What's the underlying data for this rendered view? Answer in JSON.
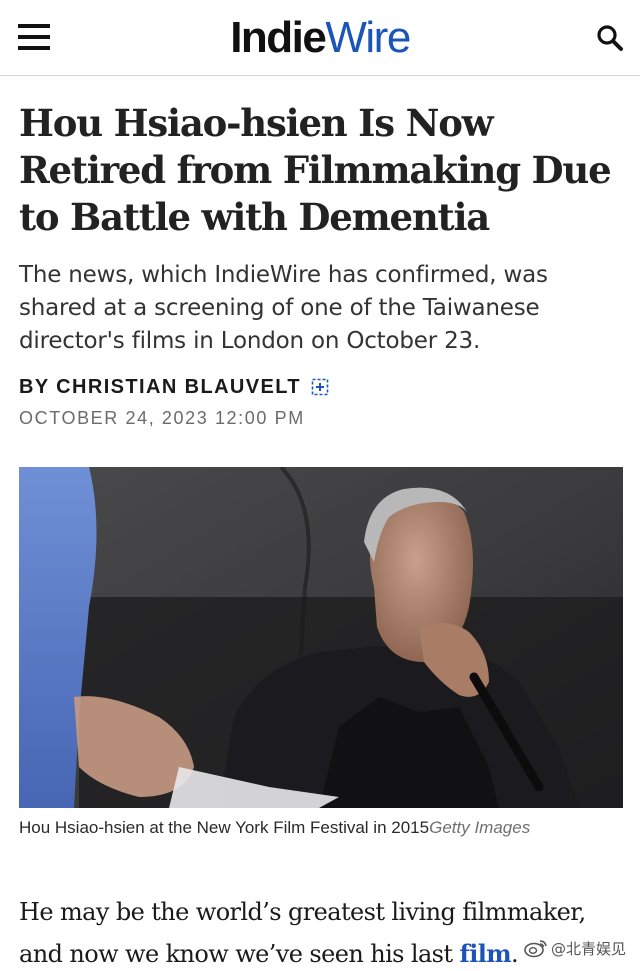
{
  "header": {
    "logo_bold": "Indie",
    "logo_light": "Wire",
    "menu_icon": "hamburger-menu-icon",
    "search_icon": "search-icon"
  },
  "article": {
    "headline": "Hou Hsiao-hsien Is Now Retired from Filmmaking Due to Battle with Dementia",
    "dek": "The news, which IndieWire has confirmed, was shared at a screening of one of the Taiwanese director's films in London on October 23.",
    "byline": "BY CHRISTIAN BLAUVELT",
    "byline_icon": "plus-square-icon",
    "date": "OCTOBER 24, 2023 12:00 PM",
    "caption": "Hou Hsiao-hsien at the New York Film Festival in 2015",
    "caption_credit": "Getty Images",
    "body_before_link": "He may be the world’s greatest living filmmaker, and now we know we’ve seen his last ",
    "body_link": "film",
    "body_after_link": "."
  },
  "watermark": {
    "icon": "weibo-icon",
    "text": "@北青娱见"
  },
  "colors": {
    "brand_blue": "#1c55b8",
    "text_dark": "#222222",
    "meta_gray": "#6b6b6b"
  }
}
